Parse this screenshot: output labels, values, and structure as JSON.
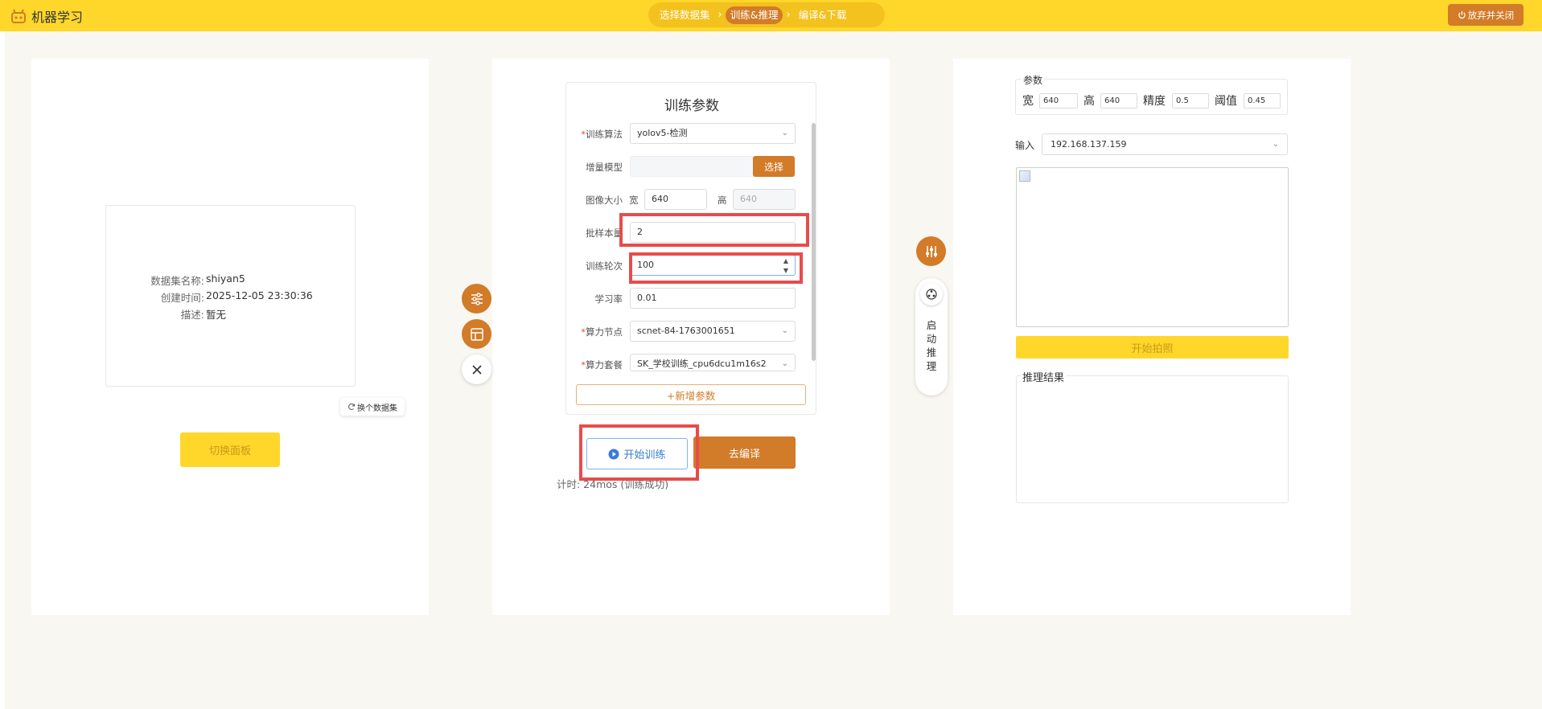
{
  "app": {
    "title": "机器学习"
  },
  "steps": [
    {
      "label": "选择数据集"
    },
    {
      "label": "训练&推理",
      "active": true
    },
    {
      "label": "编译&下载"
    }
  ],
  "header": {
    "quit_label": "放弃并关闭"
  },
  "dataset": {
    "name_key": "数据集名称:",
    "name_val": "shiyan5",
    "created_key": "创建时间:",
    "created_val": "2025-12-05 23:30:36",
    "desc_key": "描述:",
    "desc_val": "暂无",
    "swap_label": "换个数据集",
    "switch_panel_label": "切换面板"
  },
  "train": {
    "title": "训练参数",
    "algo_label": "训练算法",
    "algo_value": "yolov5-检测",
    "incr_label": "增量模型",
    "incr_value": "",
    "incr_btn": "选择",
    "imgsize_label": "图像大小",
    "width_label": "宽",
    "width_value": "640",
    "height_label": "高",
    "height_value": "640",
    "batch_label": "批样本量",
    "batch_value": "2",
    "epochs_label": "训练轮次",
    "epochs_value": "100",
    "lr_label": "学习率",
    "lr_value": "0.01",
    "node_label": "算力节点",
    "node_value": "scnet-84-1763001651",
    "pkg_label": "算力套餐",
    "pkg_value": "SK_学校训练_cpu6dcu1m16s2",
    "add_param_label": "+新增参数",
    "start_label": "开始训练",
    "compile_label": "去编译",
    "timer_text": "计时: 24mos (训练成功)"
  },
  "inference": {
    "pill_text": "启动推理",
    "params_legend": "参数",
    "w_label": "宽",
    "w_value": "640",
    "h_label": "高",
    "h_value": "640",
    "prec_label": "精度",
    "prec_value": "0.5",
    "thr_label": "阈值",
    "thr_value": "0.45",
    "input_label": "输入",
    "input_value": "192.168.137.159",
    "shoot_label": "开始拍照",
    "result_legend": "推理结果"
  },
  "colors": {
    "accent_yellow": "#fed72a",
    "accent_orange": "#d27b28",
    "highlight_red": "#e74c4c"
  }
}
